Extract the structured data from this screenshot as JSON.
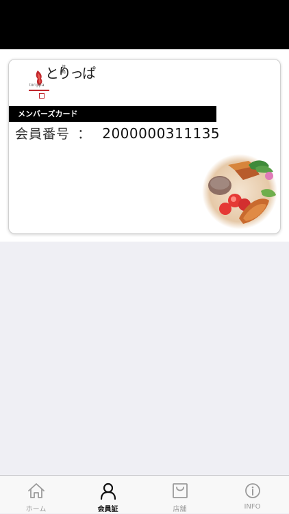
{
  "colors": {
    "status_bar": "#000000",
    "background": "#efeff4",
    "card_band": "#000000",
    "logo_accent": "#c0272d",
    "tab_active": "#111111",
    "tab_inactive": "#9a9a9a"
  },
  "card": {
    "logo": {
      "brand": "とりっぱ",
      "sub": "焼鳥",
      "roman": "torippa"
    },
    "band_title": "メンバーズカード",
    "member_label": "会員番号",
    "member_colon": "：",
    "member_number": "2000000311135",
    "image": "food-plate-photo"
  },
  "tabbar": {
    "tabs": [
      {
        "label": "ホーム",
        "icon": "home-icon",
        "active": false
      },
      {
        "label": "会員証",
        "icon": "person-icon",
        "active": true
      },
      {
        "label": "店舗",
        "icon": "shop-bag-icon",
        "active": false
      },
      {
        "label": "INFO",
        "icon": "info-icon",
        "active": false
      }
    ]
  }
}
